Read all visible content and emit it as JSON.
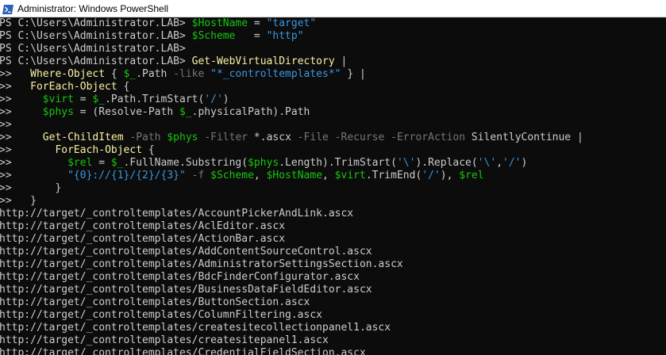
{
  "window": {
    "title": "Administrator: Windows PowerShell",
    "icon": "powershell-icon"
  },
  "colors": {
    "background": "#0c0c0c",
    "text": "#cccccc",
    "command": "#f9f1a5",
    "variable": "#16c60c",
    "string": "#3a96dd",
    "parameter": "#767676"
  },
  "console_lines": [
    [
      [
        "def",
        "PS C:\\Users\\Administrator.LAB> "
      ],
      [
        "var",
        "$HostName"
      ],
      [
        "def",
        " = "
      ],
      [
        "str",
        "\"target\""
      ]
    ],
    [
      [
        "def",
        "PS C:\\Users\\Administrator.LAB> "
      ],
      [
        "var",
        "$Scheme"
      ],
      [
        "def",
        "   = "
      ],
      [
        "str",
        "\"http\""
      ]
    ],
    [
      [
        "def",
        "PS C:\\Users\\Administrator.LAB>"
      ]
    ],
    [
      [
        "def",
        "PS C:\\Users\\Administrator.LAB> "
      ],
      [
        "cmd",
        "Get-WebVirtualDirectory"
      ],
      [
        "def",
        " |"
      ]
    ],
    [
      [
        "def",
        ">>   "
      ],
      [
        "cmd",
        "Where-Object"
      ],
      [
        "def",
        " { "
      ],
      [
        "var",
        "$_"
      ],
      [
        "def",
        ".Path "
      ],
      [
        "par",
        "-like"
      ],
      [
        "def",
        " "
      ],
      [
        "str",
        "\"*_controltemplates*\""
      ],
      [
        "def",
        " } |"
      ]
    ],
    [
      [
        "def",
        ">>   "
      ],
      [
        "cmd",
        "ForEach-Object"
      ],
      [
        "def",
        " {"
      ]
    ],
    [
      [
        "def",
        ">>     "
      ],
      [
        "var",
        "$virt"
      ],
      [
        "def",
        " = "
      ],
      [
        "var",
        "$_"
      ],
      [
        "def",
        ".Path.TrimStart("
      ],
      [
        "str",
        "'/'"
      ],
      [
        "def",
        ")"
      ]
    ],
    [
      [
        "def",
        ">>     "
      ],
      [
        "var",
        "$phys"
      ],
      [
        "def",
        " = (Resolve-Path "
      ],
      [
        "var",
        "$_"
      ],
      [
        "def",
        ".physicalPath).Path"
      ]
    ],
    [
      [
        "def",
        ">>"
      ]
    ],
    [
      [
        "def",
        ">>     "
      ],
      [
        "cmd",
        "Get-ChildItem"
      ],
      [
        "def",
        " "
      ],
      [
        "par",
        "-Path"
      ],
      [
        "def",
        " "
      ],
      [
        "var",
        "$phys"
      ],
      [
        "def",
        " "
      ],
      [
        "par",
        "-Filter"
      ],
      [
        "def",
        " *.ascx "
      ],
      [
        "par",
        "-File"
      ],
      [
        "def",
        " "
      ],
      [
        "par",
        "-Recurse"
      ],
      [
        "def",
        " "
      ],
      [
        "par",
        "-ErrorAction"
      ],
      [
        "def",
        " SilentlyContinue |"
      ]
    ],
    [
      [
        "def",
        ">>       "
      ],
      [
        "cmd",
        "ForEach-Object"
      ],
      [
        "def",
        " {"
      ]
    ],
    [
      [
        "def",
        ">>         "
      ],
      [
        "var",
        "$rel"
      ],
      [
        "def",
        " = "
      ],
      [
        "var",
        "$_"
      ],
      [
        "def",
        ".FullName.Substring("
      ],
      [
        "var",
        "$phys"
      ],
      [
        "def",
        ".Length).TrimStart("
      ],
      [
        "str",
        "'\\'"
      ],
      [
        "def",
        ").Replace("
      ],
      [
        "str",
        "'\\'"
      ],
      [
        "def",
        ","
      ],
      [
        "str",
        "'/'"
      ],
      [
        "def",
        ")"
      ]
    ],
    [
      [
        "def",
        ">>         "
      ],
      [
        "str",
        "\"{0}://{1}/{2}/{3}\""
      ],
      [
        "def",
        " "
      ],
      [
        "par",
        "-f"
      ],
      [
        "def",
        " "
      ],
      [
        "var",
        "$Scheme"
      ],
      [
        "def",
        ", "
      ],
      [
        "var",
        "$HostName"
      ],
      [
        "def",
        ", "
      ],
      [
        "var",
        "$virt"
      ],
      [
        "def",
        ".TrimEnd("
      ],
      [
        "str",
        "'/'"
      ],
      [
        "def",
        "), "
      ],
      [
        "var",
        "$rel"
      ]
    ],
    [
      [
        "def",
        ">>       }"
      ]
    ],
    [
      [
        "def",
        ">>   }"
      ]
    ],
    [
      [
        "def",
        "http://target/_controltemplates/AccountPickerAndLink.ascx"
      ]
    ],
    [
      [
        "def",
        "http://target/_controltemplates/AclEditor.ascx"
      ]
    ],
    [
      [
        "def",
        "http://target/_controltemplates/ActionBar.ascx"
      ]
    ],
    [
      [
        "def",
        "http://target/_controltemplates/AddContentSourceControl.ascx"
      ]
    ],
    [
      [
        "def",
        "http://target/_controltemplates/AdministratorSettingsSection.ascx"
      ]
    ],
    [
      [
        "def",
        "http://target/_controltemplates/BdcFinderConfigurator.ascx"
      ]
    ],
    [
      [
        "def",
        "http://target/_controltemplates/BusinessDataFieldEditor.ascx"
      ]
    ],
    [
      [
        "def",
        "http://target/_controltemplates/ButtonSection.ascx"
      ]
    ],
    [
      [
        "def",
        "http://target/_controltemplates/ColumnFiltering.ascx"
      ]
    ],
    [
      [
        "def",
        "http://target/_controltemplates/createsitecollectionpanel1.ascx"
      ]
    ],
    [
      [
        "def",
        "http://target/_controltemplates/createsitepanel1.ascx"
      ]
    ],
    [
      [
        "def",
        "http://target/_controltemplates/CredentialFieldSection.ascx"
      ]
    ]
  ]
}
